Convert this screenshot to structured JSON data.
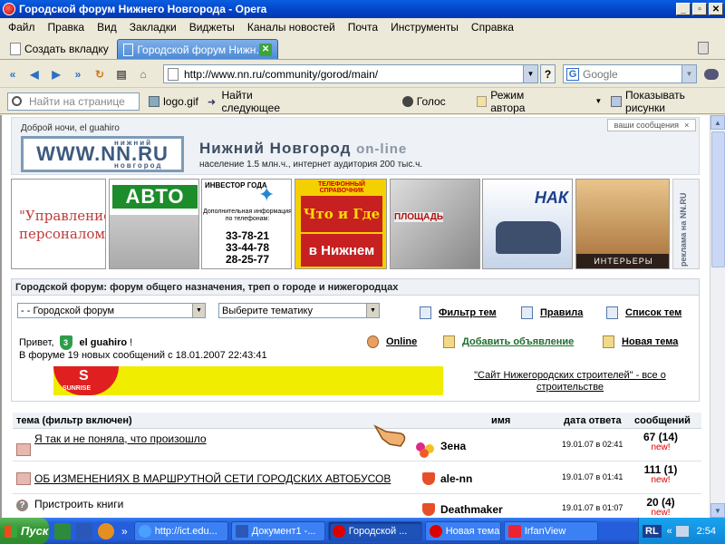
{
  "window": {
    "title": "Городской форум Нижнего Новгорода - Opera"
  },
  "menu": [
    "Файл",
    "Правка",
    "Вид",
    "Закладки",
    "Виджеты",
    "Каналы новостей",
    "Почта",
    "Инструменты",
    "Справка"
  ],
  "tabs": {
    "new_tab": "Создать вкладку",
    "active_tab": "Городской форум Нижн..."
  },
  "address": {
    "url": "http://www.nn.ru/community/gorod/main/",
    "help": "?",
    "search_placeholder": "Google"
  },
  "personal_bar": {
    "find_placeholder": "Найти на странице",
    "items": [
      "logo.gif",
      "Найти следующее",
      "Голос",
      "Режим автора",
      "Показывать рисунки"
    ]
  },
  "site": {
    "greeting": "Доброй ночи, el guahiro",
    "messages_button": "ваши сообщения",
    "logo_top": "нижний",
    "logo_main": "WWW.NN.RU",
    "logo_bottom": "новгород",
    "city": "Нижний Новгород",
    "city_online": "on-line",
    "city_sub": "население 1.5 млн.ч., интернет аудитория 200 тыс.ч."
  },
  "banners": {
    "b1": "\"Управление персоналом\"",
    "b2": "АВТО",
    "b3_head": "ИНВЕСТОР ГОДА",
    "b3_desc": "Дополнительная информация по телефонам:",
    "b3_phones": [
      "33-78-21",
      "33-44-78",
      "28-25-77"
    ],
    "b4_head": "ТЕЛЕФОННЫЙ СПРАВОЧНИК",
    "b4_main": "Что и Где",
    "b4_bottom": "в Нижнем",
    "b5": "ПЛОЩАДЬ",
    "b6": "НАК",
    "b7": "ИНТЕРЬЕРЫ",
    "b8": "реклама на NN.RU"
  },
  "forum": {
    "title": "Городской форум: форум общего назначения, треп о городе и нижегородцах",
    "select_forum": "- - Городской форум",
    "select_topic": "Выберите тематику",
    "filter_link": "Фильтр тем",
    "rules_link": "Правила",
    "topics_link": "Список тем",
    "hello_prefix": "Привет,",
    "user_level": "3",
    "user_name": "el guahiro",
    "hello_suffix": "!",
    "stats": "В форуме 19 новых сообщений с 18.01.2007 22:43:41",
    "online_link": "Online",
    "add_ad_link": "Добавить объявление",
    "new_topic_link": "Новая тема",
    "ad_logo": "S",
    "ad_brand": "SUNRISE",
    "ad_link": "\"Сайт Нижегородских строителей\" - все о строительстве"
  },
  "table": {
    "headers": [
      "тема (фильтр включен)",
      "имя",
      "дата ответа",
      "сообщений"
    ],
    "rows": [
      {
        "topic": "Я так и не поняла, что произошло",
        "user": "Зена",
        "date": "19.01.07 в 02:41",
        "count": "67 (14)",
        "new": "new!"
      },
      {
        "topic": "ОБ ИЗМЕНЕНИЯХ В МАРШРУТНОЙ СЕТИ ГОРОДСКИХ АВТОБУСОВ",
        "user": "ale-nn",
        "date": "19.01.07 в 01:41",
        "count": "111 (1)",
        "new": "new!"
      },
      {
        "topic": "Пристроить книги",
        "user": "Deathmaker",
        "date": "19.01.07 в 01:07",
        "count": "20 (4)",
        "new": "new!"
      }
    ]
  },
  "taskbar": {
    "start": "Пуск",
    "tasks": [
      "http://ict.edu...",
      "Документ1 -...",
      "Городской ...",
      "Новая тема",
      "IrfanView"
    ],
    "lang": "RL",
    "clock": "2:54"
  },
  "colors": {
    "title_bar": "#0443c6",
    "taskbar": "#245edb",
    "start": "#349934",
    "new_badge": "#e00000"
  }
}
